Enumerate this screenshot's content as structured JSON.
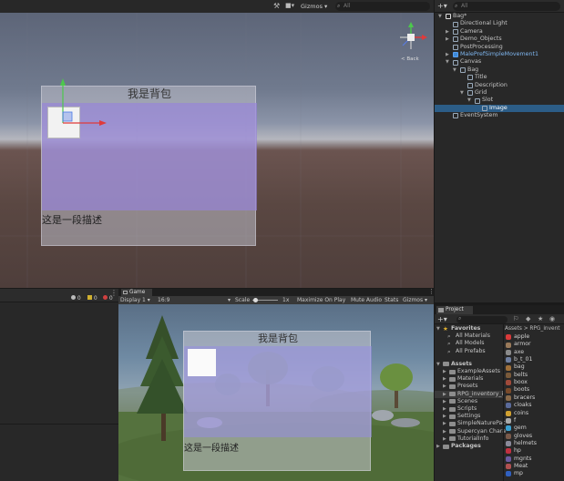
{
  "scene": {
    "toolbar": {
      "gizmos_label": "Gizmos",
      "search_placeholder": "All"
    },
    "gizmo": {
      "view_label": "< Back"
    },
    "ui_panel": {
      "title": "我是背包",
      "description": "这是一段描述"
    }
  },
  "hierarchy": {
    "search_placeholder": "All",
    "items": [
      {
        "label": "Bag*",
        "depth": 0,
        "arrow": "▼",
        "scene": true
      },
      {
        "label": "Directional Light",
        "depth": 1,
        "arrow": ""
      },
      {
        "label": "Camera",
        "depth": 1,
        "arrow": "▶"
      },
      {
        "label": "Demo_Objects",
        "depth": 1,
        "arrow": "▶"
      },
      {
        "label": "PostProcessing",
        "depth": 1,
        "arrow": ""
      },
      {
        "label": "MalePrefSimpleMovement1",
        "depth": 1,
        "arrow": "▶",
        "prefab": true
      },
      {
        "label": "Canvas",
        "depth": 1,
        "arrow": "▼"
      },
      {
        "label": "Bag",
        "depth": 2,
        "arrow": "▼"
      },
      {
        "label": "Title",
        "depth": 3,
        "arrow": ""
      },
      {
        "label": "Description",
        "depth": 3,
        "arrow": ""
      },
      {
        "label": "Grid",
        "depth": 3,
        "arrow": "▼"
      },
      {
        "label": "Slot",
        "depth": 4,
        "arrow": "▼"
      },
      {
        "label": "Image",
        "depth": 5,
        "arrow": "",
        "selected": true
      },
      {
        "label": "EventSystem",
        "depth": 1,
        "arrow": ""
      }
    ]
  },
  "console": {
    "counts": [
      "0",
      "0",
      "0"
    ]
  },
  "game": {
    "tab_label": "Game",
    "display": "Display 1",
    "aspect": "16:9",
    "scale_label": "Scale",
    "scale_value": "1x",
    "maximize": "Maximize On Play",
    "mute": "Mute Audio",
    "stats": "Stats",
    "gizmos": "Gizmos",
    "ui_title": "我是背包",
    "ui_description": "这是一段描述"
  },
  "project": {
    "tab_label": "Project",
    "favorites_label": "Favorites",
    "favorites": [
      "All Materials",
      "All Models",
      "All Prefabs"
    ],
    "assets_label": "Assets",
    "folders": [
      "ExampleAssets",
      "Materials",
      "Presets",
      "RPG_inventory_i",
      "Scenes",
      "Scripts",
      "Settings",
      "SimpleNaturePac",
      "Supercyan Chara",
      "TutorialInfo"
    ],
    "packages_label": "Packages",
    "breadcrumb": "Assets > RPG_invent",
    "assets": [
      {
        "name": "apple",
        "color": "#d93a3a"
      },
      {
        "name": "armor",
        "color": "#9a7a5a"
      },
      {
        "name": "axe",
        "color": "#8a8a8a"
      },
      {
        "name": "b_t_01",
        "color": "#6f7fa0"
      },
      {
        "name": "bag",
        "color": "#a0703a"
      },
      {
        "name": "belts",
        "color": "#7a5a3a"
      },
      {
        "name": "boox",
        "color": "#a04a3a"
      },
      {
        "name": "boots",
        "color": "#7a4a2a"
      },
      {
        "name": "bracers",
        "color": "#8a6a4a"
      },
      {
        "name": "cloaks",
        "color": "#5a6a9a"
      },
      {
        "name": "coins",
        "color": "#d0a030"
      },
      {
        "name": "f",
        "color": "#aaaaaa"
      },
      {
        "name": "gem",
        "color": "#3aa0d0"
      },
      {
        "name": "gloves",
        "color": "#7a5a4a"
      },
      {
        "name": "helmets",
        "color": "#8a8a9a"
      },
      {
        "name": "hp",
        "color": "#c03040"
      },
      {
        "name": "mgnts",
        "color": "#6a5aa0"
      },
      {
        "name": "Meat",
        "color": "#b05050"
      },
      {
        "name": "mp",
        "color": "#3060c0"
      }
    ]
  }
}
